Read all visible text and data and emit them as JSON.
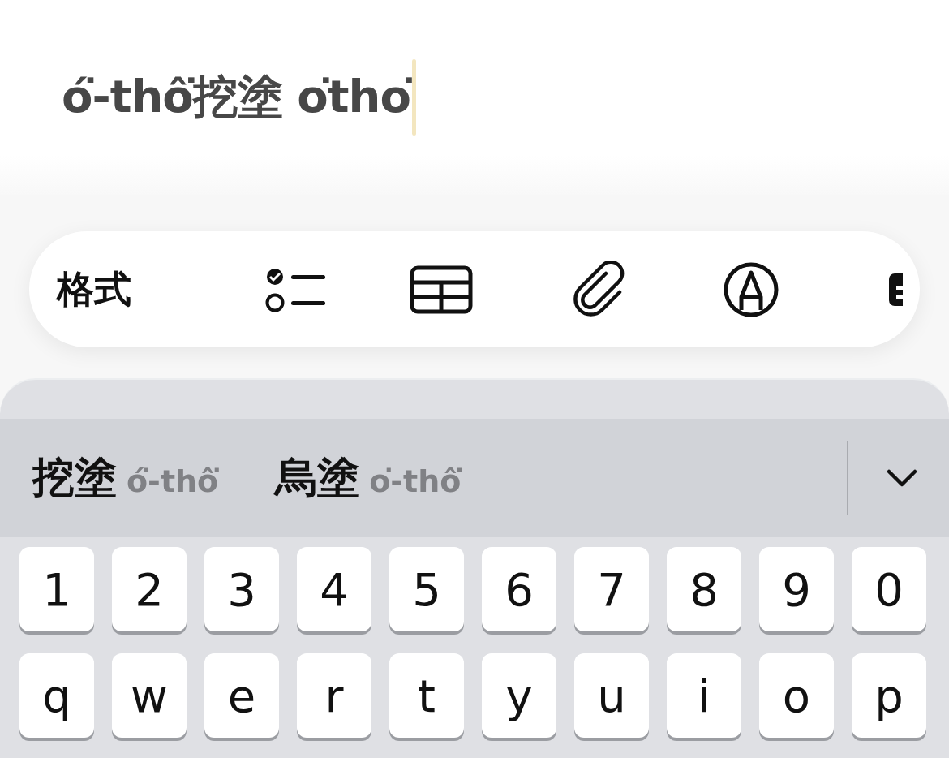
{
  "note": {
    "text": "ó͘-thô͘挖塗 o͘tho͘"
  },
  "toolbar": {
    "items": [
      {
        "kind": "text",
        "label": "格式"
      },
      {
        "kind": "checklist"
      },
      {
        "kind": "table"
      },
      {
        "kind": "attachment"
      },
      {
        "kind": "markup"
      },
      {
        "kind": "clipped"
      }
    ]
  },
  "candidates": [
    {
      "word": "挖塗",
      "reading": "ó͘-thô͘"
    },
    {
      "word": "烏塗",
      "reading": "o͘-thô͘"
    }
  ],
  "keyboard": {
    "rows": [
      [
        "1",
        "2",
        "3",
        "4",
        "5",
        "6",
        "7",
        "8",
        "9",
        "0"
      ],
      [
        "q",
        "w",
        "e",
        "r",
        "t",
        "y",
        "u",
        "i",
        "o",
        "p"
      ]
    ]
  }
}
